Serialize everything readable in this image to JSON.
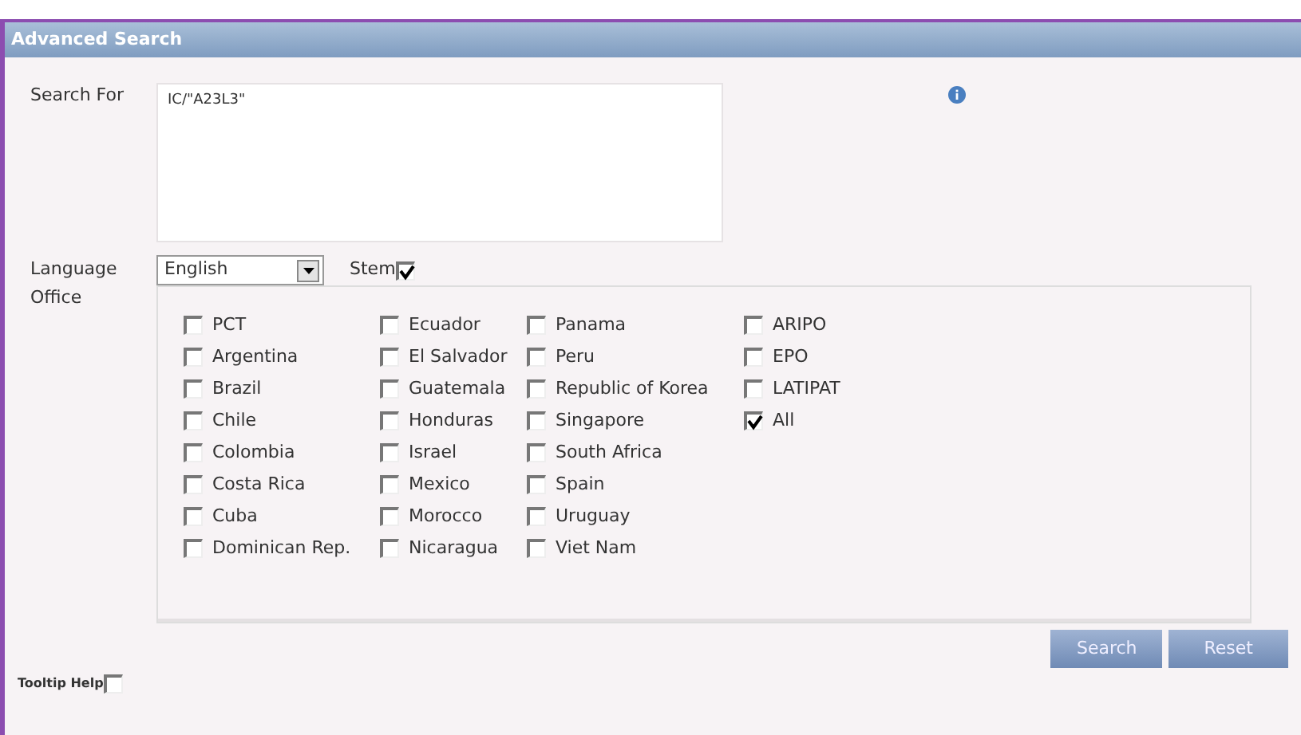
{
  "window": {
    "title": "Advanced Search"
  },
  "search_for": {
    "label": "Search For",
    "value": "IC/\"A23L3\""
  },
  "language": {
    "label": "Language",
    "value": "English"
  },
  "stem": {
    "label": "Stem",
    "checked": true
  },
  "office": {
    "label": "Office",
    "columns": [
      [
        {
          "label": "PCT",
          "checked": false
        },
        {
          "label": "Argentina",
          "checked": false
        },
        {
          "label": "Brazil",
          "checked": false
        },
        {
          "label": "Chile",
          "checked": false
        },
        {
          "label": "Colombia",
          "checked": false
        },
        {
          "label": "Costa Rica",
          "checked": false
        },
        {
          "label": "Cuba",
          "checked": false
        },
        {
          "label": "Dominican Rep.",
          "checked": false
        }
      ],
      [
        {
          "label": "Ecuador",
          "checked": false
        },
        {
          "label": "El Salvador",
          "checked": false
        },
        {
          "label": "Guatemala",
          "checked": false
        },
        {
          "label": "Honduras",
          "checked": false
        },
        {
          "label": "Israel",
          "checked": false
        },
        {
          "label": "Mexico",
          "checked": false
        },
        {
          "label": "Morocco",
          "checked": false
        },
        {
          "label": "Nicaragua",
          "checked": false
        }
      ],
      [
        {
          "label": "Panama",
          "checked": false
        },
        {
          "label": "Peru",
          "checked": false
        },
        {
          "label": "Republic of Korea",
          "checked": false
        },
        {
          "label": "Singapore",
          "checked": false
        },
        {
          "label": "South Africa",
          "checked": false
        },
        {
          "label": "Spain",
          "checked": false
        },
        {
          "label": "Uruguay",
          "checked": false
        },
        {
          "label": "Viet Nam",
          "checked": false
        }
      ],
      [
        {
          "label": "ARIPO",
          "checked": false
        },
        {
          "label": "EPO",
          "checked": false
        },
        {
          "label": "LATIPAT",
          "checked": false
        },
        {
          "label": "All",
          "checked": true
        }
      ]
    ]
  },
  "buttons": [
    "Search",
    "Reset"
  ],
  "tooltip_help": {
    "label": "Tooltip Help",
    "checked": false
  }
}
